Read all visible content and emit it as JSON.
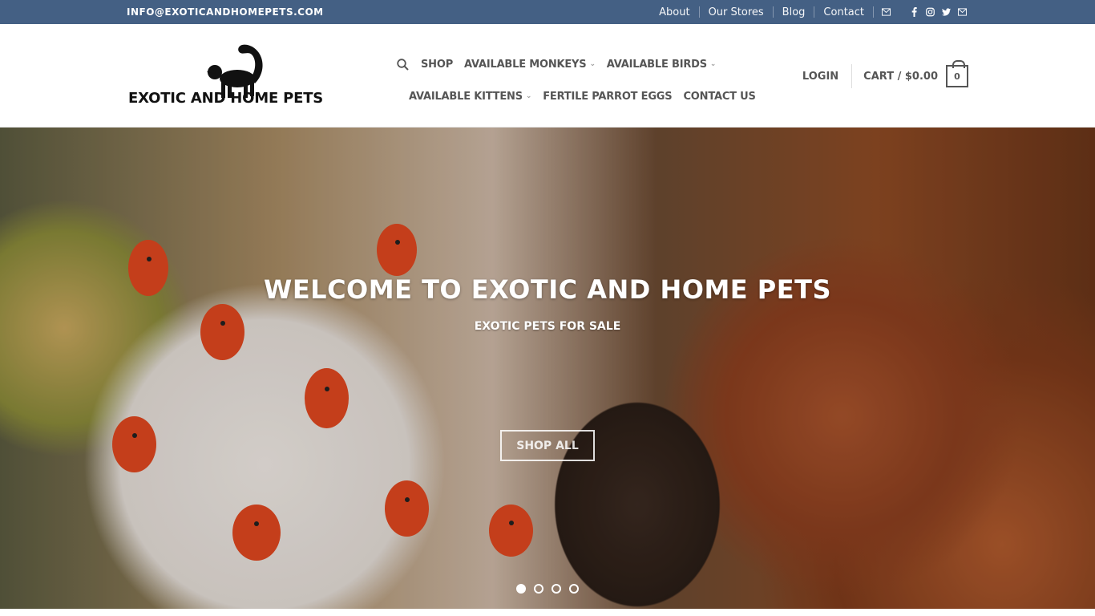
{
  "topbar": {
    "email": "INFO@EXOTICANDHOMEPETS.COM",
    "links": [
      "About",
      "Our Stores",
      "Blog",
      "Contact"
    ],
    "social_icons": [
      "email-icon",
      "facebook-icon",
      "instagram-icon",
      "twitter-icon",
      "envelope-icon"
    ],
    "background": "#446084"
  },
  "header": {
    "logo_text": "EXOTIC AND HOME PETS",
    "nav_row1": [
      {
        "label": "SHOP",
        "dropdown": false
      },
      {
        "label": "AVAILABLE MONKEYS",
        "dropdown": true
      },
      {
        "label": "AVAILABLE BIRDS",
        "dropdown": true
      }
    ],
    "nav_row2": [
      {
        "label": "AVAILABLE KITTENS",
        "dropdown": true
      },
      {
        "label": "FERTILE PARROT EGGS",
        "dropdown": false
      },
      {
        "label": "CONTACT US",
        "dropdown": false
      }
    ],
    "login": "LOGIN",
    "cart_label": "CART / $0.00",
    "cart_count": "0"
  },
  "hero": {
    "title": "WELCOME TO EXOTIC AND HOME PETS",
    "subtitle": "EXOTIC PETS FOR SALE",
    "button": "SHOP ALL",
    "slides": 4,
    "active_slide": 1
  }
}
